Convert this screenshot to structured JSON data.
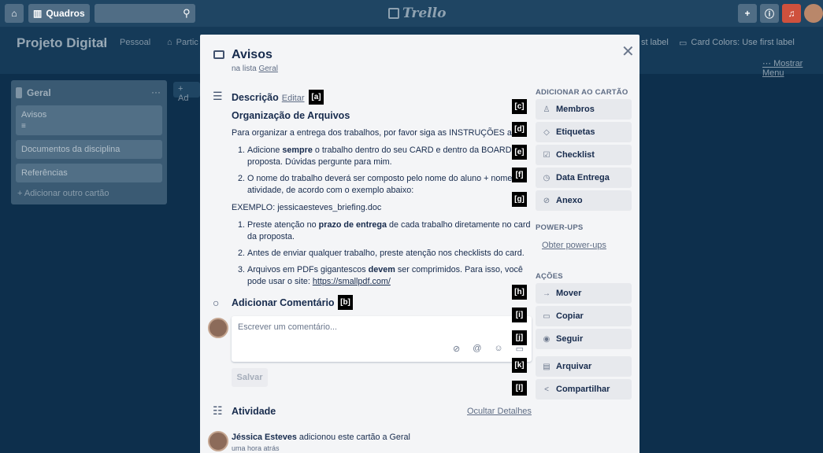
{
  "topbar": {
    "boards_label": "Quadros",
    "logo_text": "Trello"
  },
  "board": {
    "title": "Projeto Digital",
    "visibility_label": "Pessoal",
    "team_label": "Partic",
    "powerup_label_1": "st label",
    "powerup_label_2": "Card Colors: Use first label",
    "menu_link": "Mostrar Menu"
  },
  "list": {
    "title": "Geral",
    "cards": [
      "Avisos",
      "Documentos da disciplina",
      "Referências"
    ],
    "add_card": "+ Adicionar outro cartão",
    "add_list": "+ Ad"
  },
  "modal": {
    "title": "Avisos",
    "in_list_prefix": "na lista",
    "in_list_name": "Geral",
    "description_heading": "Descrição",
    "edit_label": "Editar",
    "desc_title": "Organização de Arquivos",
    "desc_intro": "Para organizar a entrega dos trabalhos, por favor siga as INSTRUÇÕES abai",
    "list1": [
      {
        "before": "Adicione ",
        "bold": "sempre",
        "after": " o trabalho dentro do seu CARD e dentro da BOARD da proposta. Dúvidas pergunte para mim."
      },
      {
        "before": "O nome do trabalho deverá ser composto pelo nome do aluno + nome d atividade, de acordo com o exemplo abaixo:",
        "bold": "",
        "after": ""
      }
    ],
    "example": "EXEMPLO: jessicaesteves_briefing.doc",
    "list2": [
      {
        "before": "Preste atenção no ",
        "bold": "prazo de entrega",
        "after": " de cada trabalho diretamente no card da proposta."
      },
      {
        "before": "Antes de enviar qualquer trabalho, preste atenção nos checklists do card.",
        "bold": "",
        "after": ""
      },
      {
        "before": "Arquivos em PDFs gigantescos ",
        "bold": "devem",
        "after": " ser comprimidos. Para isso, você pode usar o site: "
      }
    ],
    "link": "https://smallpdf.com/",
    "comment_heading": "Adicionar Comentário",
    "comment_placeholder": "Escrever um comentário...",
    "save_label": "Salvar",
    "activity_heading": "Atividade",
    "hide_details": "Ocultar Detalhes",
    "activity_user": "Jéssica Esteves",
    "activity_action": "adicionou este cartão a Geral",
    "activity_time": "uma hora atrás"
  },
  "sidebar": {
    "add_heading": "ADICIONAR AO CARTÃO",
    "add_buttons": [
      "Membros",
      "Etiquetas",
      "Checklist",
      "Data Entrega",
      "Anexo"
    ],
    "powerups_heading": "POWER-UPS",
    "powerups_link": "Obter power-ups",
    "actions_heading": "AÇÕES",
    "action_buttons": [
      "Mover",
      "Copiar",
      "Seguir",
      "Arquivar",
      "Compartilhar"
    ]
  },
  "annotations": [
    "[a]",
    "[b]",
    "[c]",
    "[d]",
    "[e]",
    "[f]",
    "[g]",
    "[h]",
    "[i]",
    "[j]",
    "[k]",
    "[l]"
  ],
  "icons": {
    "home": "home-icon",
    "boards": "boards-icon",
    "search": "search-icon",
    "plus": "plus-icon",
    "info": "info-icon",
    "bell": "bell-icon",
    "close": "close-icon",
    "card": "card-icon",
    "description": "description-icon",
    "comment": "comment-icon",
    "activity": "activity-icon",
    "member": "person-icon",
    "label": "tag-icon",
    "checklist": "checkbox-icon",
    "clock": "clock-icon",
    "attachment": "paperclip-icon",
    "arrow": "arrow-right-icon",
    "copy": "copy-icon",
    "eye": "eye-icon",
    "archive": "archive-icon",
    "share": "share-icon"
  }
}
